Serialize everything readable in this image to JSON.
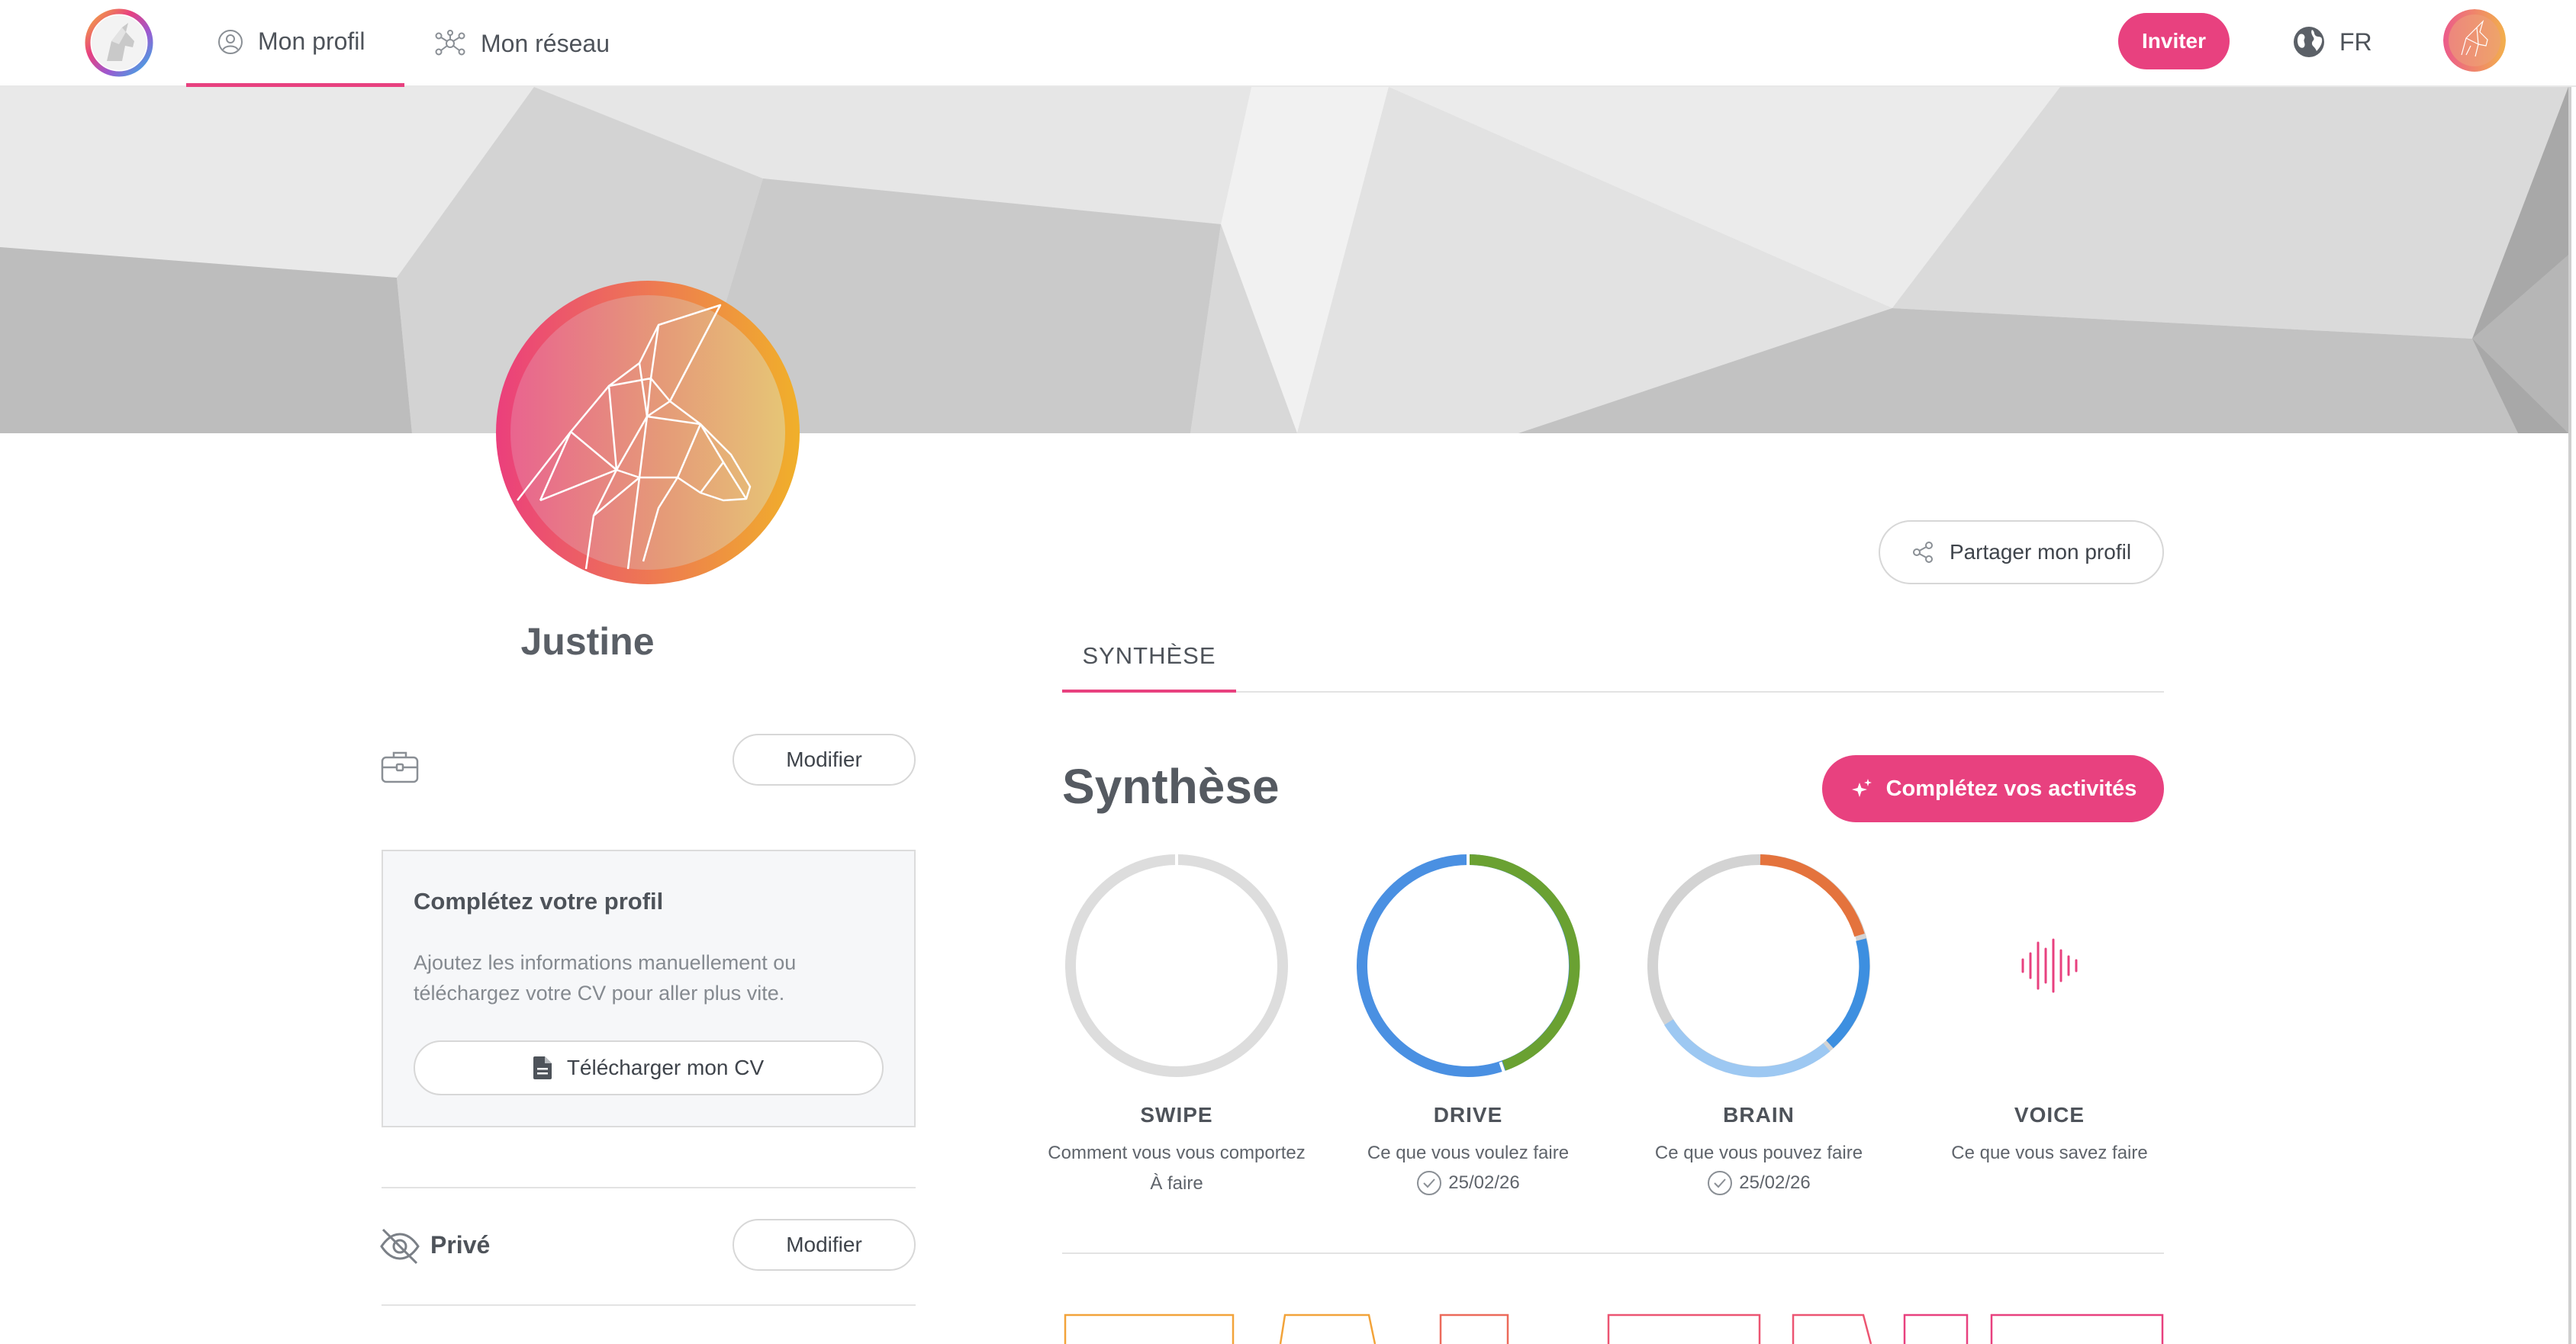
{
  "nav": {
    "tabs": [
      {
        "label": "Mon profil",
        "icon": "user-circle-icon",
        "active": true
      },
      {
        "label": "Mon réseau",
        "icon": "network-icon",
        "active": false
      }
    ],
    "invite_label": "Inviter",
    "language": "FR"
  },
  "profile": {
    "name": "Justine",
    "modify_label": "Modifier",
    "complete_card": {
      "title": "Complétez votre profil",
      "text": "Ajoutez les informations manuellement ou téléchargez votre CV pour aller plus vite.",
      "cv_button": "Télécharger mon CV"
    },
    "privacy_label": "Privé",
    "privacy_modify_label": "Modifier"
  },
  "main": {
    "share_label": "Partager mon profil",
    "tab_label": "SYNTHÈSE",
    "section_title": "Synthèse",
    "complete_activities_label": "Complétez vos activités",
    "activities": [
      {
        "name": "SWIPE",
        "desc_line1": "Comment vous vous comportez",
        "desc_line2": "À faire",
        "status": "todo"
      },
      {
        "name": "DRIVE",
        "desc_line1": "Ce que vous voulez faire",
        "date": "25/02/26",
        "status": "done"
      },
      {
        "name": "BRAIN",
        "desc_line1": "Ce que vous pouvez faire",
        "date": "25/02/26",
        "status": "done"
      },
      {
        "name": "VOICE",
        "desc_line1": "Ce que vous savez faire",
        "status": "voice"
      }
    ]
  },
  "colors": {
    "accent": "#e8417f",
    "drive_blue": "#4a90e2",
    "drive_green": "#6aa132",
    "brain_orange": "#e4733d",
    "brain_blue": "#3d8fe0",
    "brain_light_blue": "#9dc8f2",
    "ring_grey": "#dddddd"
  }
}
